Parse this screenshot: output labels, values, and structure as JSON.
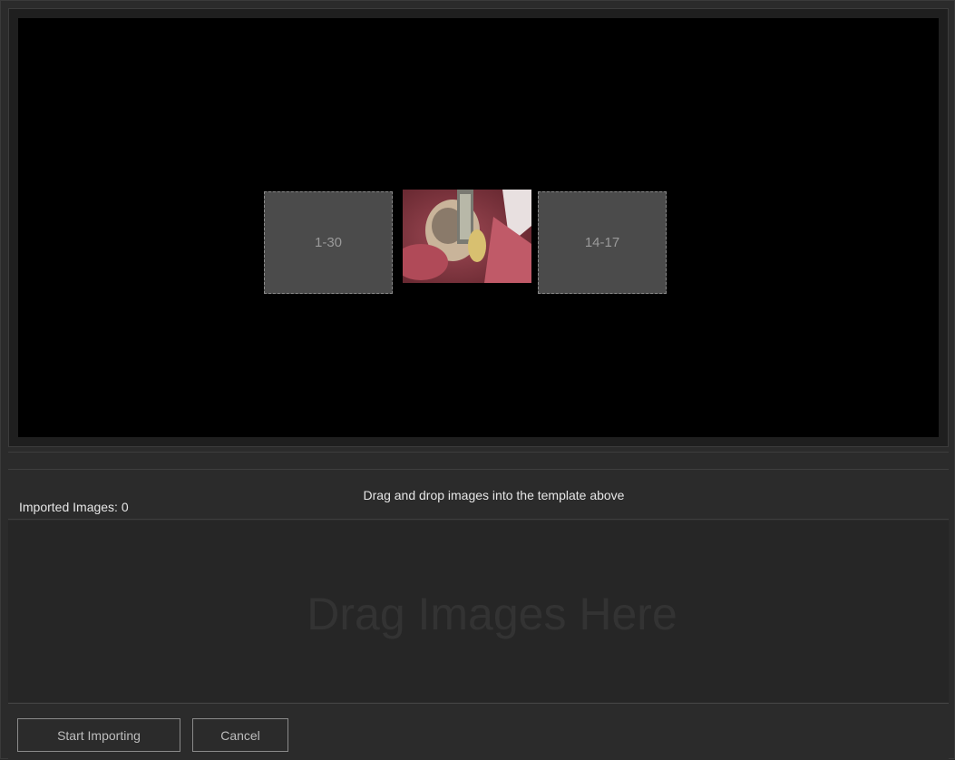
{
  "template": {
    "slots": [
      {
        "label": "1-30"
      },
      {
        "label": "14-17"
      }
    ],
    "photo": {
      "icon": "dental-photo-thumbnail"
    }
  },
  "status": {
    "imported_label": "Imported Images: 0",
    "hint": "Drag and drop images into the template above"
  },
  "drop_zone": {
    "placeholder": "Drag Images Here"
  },
  "buttons": {
    "start": "Start Importing",
    "cancel": "Cancel"
  },
  "colors": {
    "background": "#2b2b2b",
    "canvas": "#000000",
    "slot": "#4b4b4b"
  }
}
